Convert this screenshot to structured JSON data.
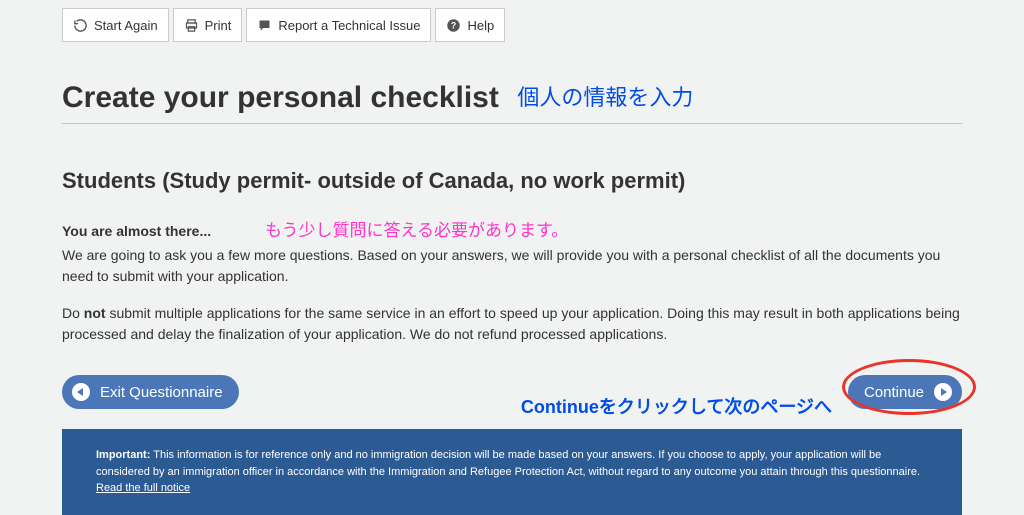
{
  "toolbar": {
    "start_again": "Start Again",
    "print": "Print",
    "report": "Report a Technical Issue",
    "help": "Help"
  },
  "title": "Create your personal checklist",
  "title_annotation": "個人の情報を入力",
  "subtitle": "Students (Study permit- outside of Canada, no work permit)",
  "almost": "You are almost there...",
  "almost_annotation": "もう少し質問に答える必要があります。",
  "para1": "We are going to ask you a few more questions. Based on your answers, we will provide you with a personal checklist of all the documents you need to submit with your application.",
  "para2_a": "Do ",
  "para2_bold": "not",
  "para2_b": " submit multiple applications for the same service in an effort to speed up your application.  Doing this may result in both applications being processed and delay the finalization of your application. We do not refund processed applications.",
  "buttons": {
    "exit": "Exit Questionnaire",
    "continue": "Continue"
  },
  "continue_annotation": "Continueをクリックして次のページへ",
  "important": {
    "label": "Important:",
    "text": " This information is for reference only and no immigration decision will be made based on your answers. If you choose to apply, your application will be considered by an immigration officer in accordance with the Immigration and Refugee Protection Act, without regard to any outcome you attain through this questionnaire. ",
    "link": "Read the full notice"
  }
}
